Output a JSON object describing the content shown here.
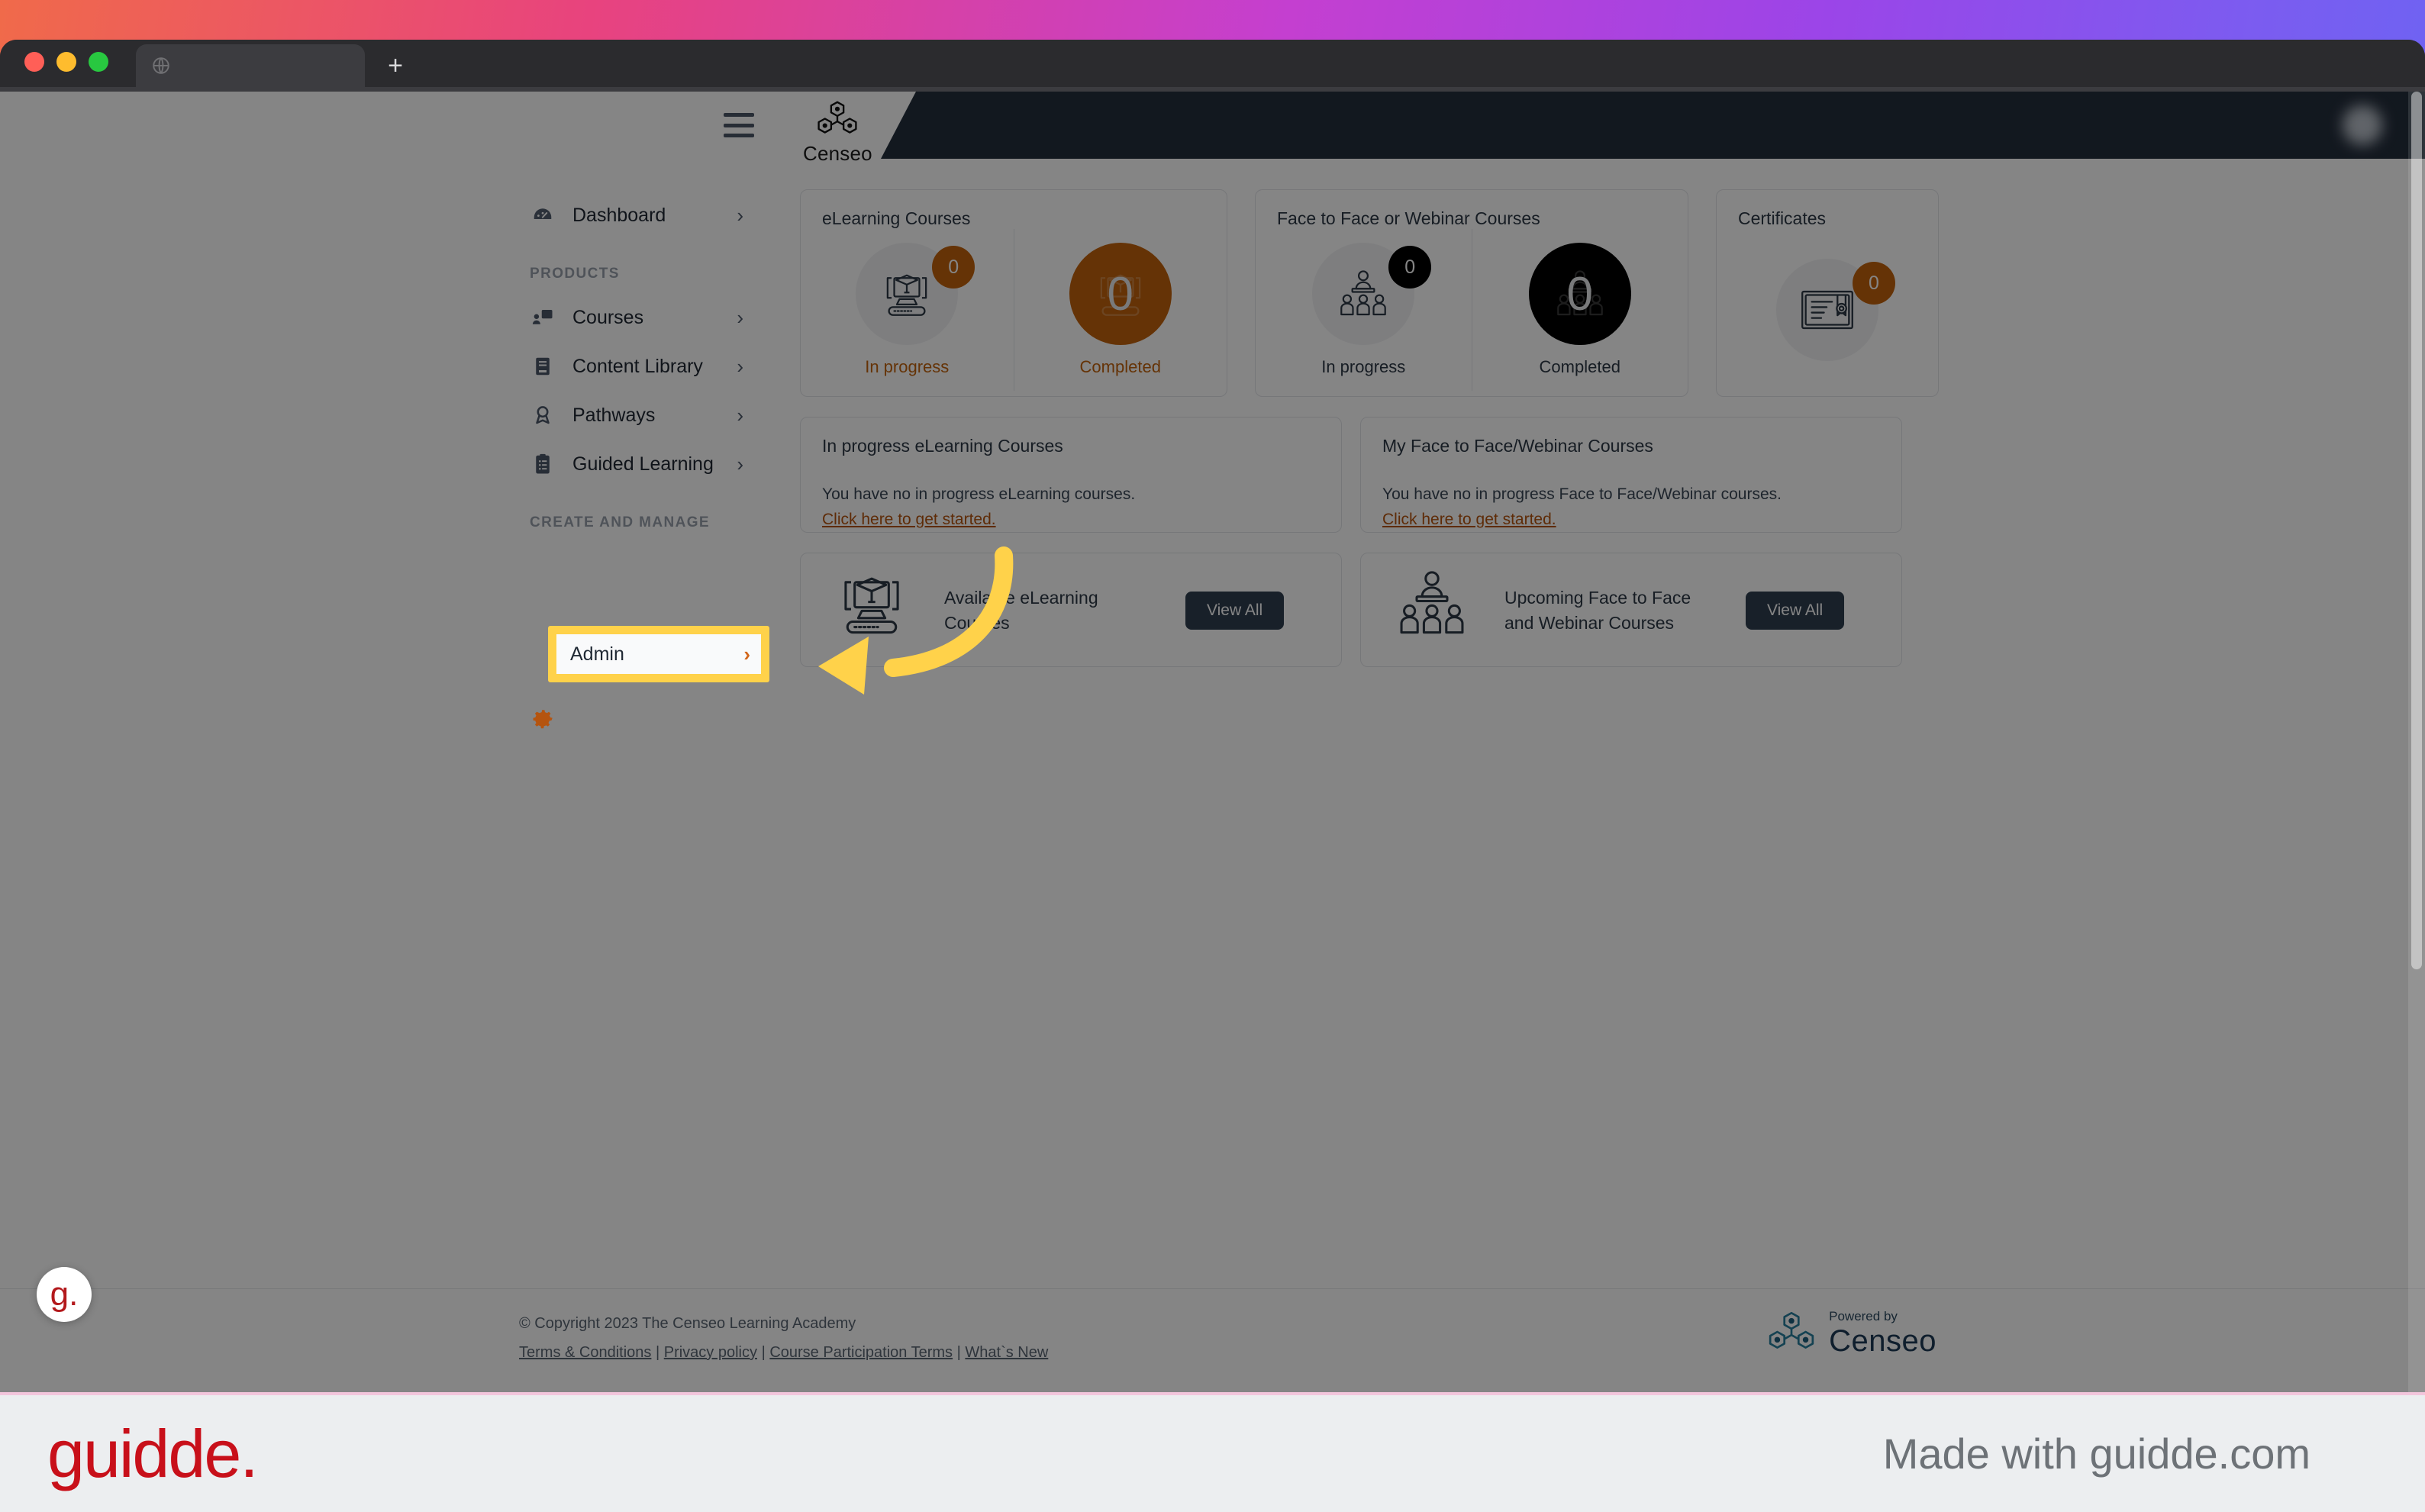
{
  "browser": {
    "tab_title": "",
    "url_value": "",
    "new_tab_label": "+",
    "back_icon": "back-arrow-icon",
    "forward_icon": "forward-arrow-icon",
    "reload_icon": "reload-icon",
    "home_icon": "home-icon"
  },
  "header": {
    "menu_icon": "hamburger-menu-icon",
    "brand_name": "Censeo",
    "brand_logo_icon": "censeo-hexagon-logo-icon",
    "user_name": "",
    "avatar_icon": "user-avatar"
  },
  "sidebar": {
    "items": [
      {
        "label": "Dashboard",
        "icon": "dashboard-gauge-icon",
        "chevron": "›"
      },
      {
        "label": "Courses",
        "icon": "courses-screen-icon",
        "chevron": "›"
      },
      {
        "label": "Content Library",
        "icon": "content-library-book-icon",
        "chevron": "›"
      },
      {
        "label": "Pathways",
        "icon": "pathways-ribbon-icon",
        "chevron": "›"
      },
      {
        "label": "Guided Learning",
        "icon": "guided-learning-clipboard-icon",
        "chevron": "›"
      },
      {
        "label": "Admin",
        "icon": "admin-gear-icon",
        "chevron": "›"
      }
    ],
    "group_products": "PRODUCTS",
    "group_create_manage": "CREATE AND MANAGE",
    "highlight_color": "#ffd24a"
  },
  "stats": [
    {
      "title": "eLearning Courses",
      "in_progress": {
        "label": "In progress",
        "count": "0",
        "icon": "elearning-monitor-cap-icon",
        "badge_color": "#c2620c",
        "label_color": "#c2620c"
      },
      "completed": {
        "label": "Completed",
        "count": "0",
        "icon": "elearning-monitor-cap-icon",
        "circle_color": "#c2620c",
        "label_color": "#c2620c"
      }
    },
    {
      "title": "Face to Face or Webinar Courses",
      "in_progress": {
        "label": "In progress",
        "count": "0",
        "icon": "classroom-people-icon",
        "badge_color": "#000000",
        "label_color": "#2c3845"
      },
      "completed": {
        "label": "Completed",
        "count": "0",
        "icon": "classroom-people-icon",
        "circle_color": "#000000",
        "label_color": "#2c3845"
      }
    }
  ],
  "certificates": {
    "title": "Certificates",
    "count": "0",
    "icon": "certificate-icon",
    "badge_color": "#c2620c"
  },
  "progress_cards": [
    {
      "title": "In progress eLearning Courses",
      "empty_text": "You have no in progress eLearning courses.",
      "link_text": "Click here to get started."
    },
    {
      "title": "My Face to Face/Webinar Courses",
      "empty_text": "You have no in progress Face to Face/Webinar courses.",
      "link_text": "Click here to get started."
    }
  ],
  "available_cards": [
    {
      "title": "Available eLearning Courses",
      "button_label": "View All",
      "icon": "elearning-monitor-cap-icon"
    },
    {
      "title": "Upcoming Face to Face and Webinar Courses",
      "button_label": "View All",
      "icon": "classroom-people-icon"
    }
  ],
  "footer": {
    "copyright": "© Copyright 2023 The Censeo Learning Academy",
    "links": [
      "Terms & Conditions",
      "Privacy policy",
      "Course Participation Terms",
      "What`s New"
    ],
    "separator": "|",
    "powered_small": "Powered by",
    "powered_big": "Censeo",
    "powered_icon": "censeo-hexagon-logo-icon"
  },
  "guidde": {
    "badge_text": "g.",
    "wordmark": "guidde.",
    "made_with": "Made with guidde.com",
    "arrow_color": "#ffd24a",
    "arrow_icon": "pointer-arrow-icon"
  }
}
